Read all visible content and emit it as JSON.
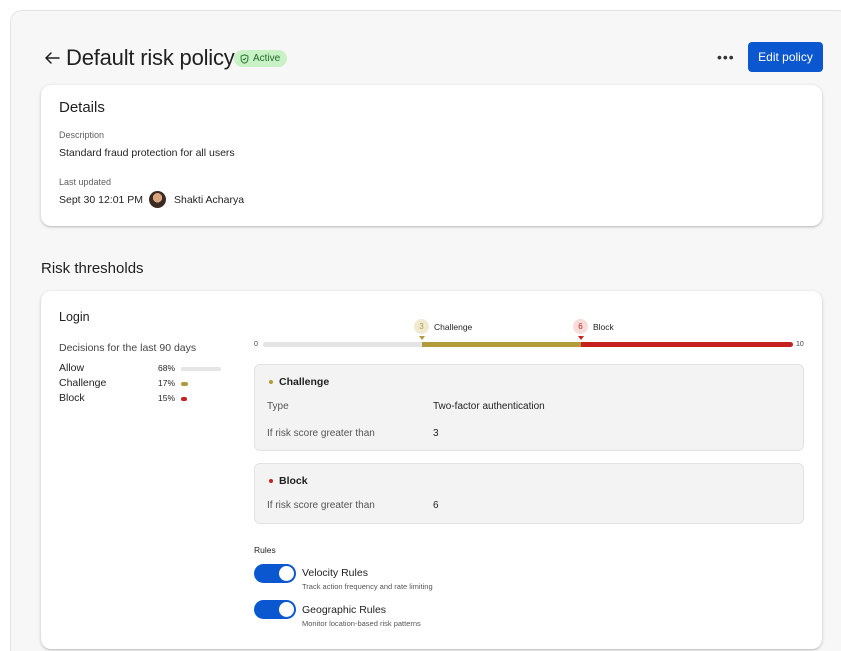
{
  "header": {
    "title": "Default risk policy",
    "status": "Active",
    "more_label": "•••",
    "edit_label": "Edit policy"
  },
  "details": {
    "title": "Details",
    "description_label": "Description",
    "description_value": "Standard fraud protection for all users",
    "updated_label": "Last updated",
    "updated_value": "Sept 30 12:01 PM",
    "updated_by": "Shakti Acharya"
  },
  "risk_thresholds": {
    "heading": "Risk thresholds",
    "login": {
      "title": "Login",
      "decisions_heading": "Decisions for the last 90 days",
      "decisions": [
        {
          "name": "Allow",
          "percent": "68%",
          "fraction": 0.68,
          "color": "#e6e6e6"
        },
        {
          "name": "Challenge",
          "percent": "17%",
          "fraction": 0.17,
          "color": "#b39a3a"
        },
        {
          "name": "Block",
          "percent": "15%",
          "fraction": 0.15,
          "color": "#c5221f"
        }
      ],
      "scale": {
        "min": "0",
        "max": "10",
        "min_value": 0,
        "max_value": 10
      },
      "markers": [
        {
          "value": 3,
          "label": "Challenge",
          "color": "#b39a3a",
          "badge_bg": "#f1ead2"
        },
        {
          "value": 6,
          "label": "Block",
          "color": "#c5221f",
          "badge_bg": "#f8dcda"
        }
      ],
      "challenge": {
        "title": "Challenge",
        "type_label": "Type",
        "type_value": "Two-factor authentication",
        "threshold_label": "If risk score greater than",
        "threshold_value": "3"
      },
      "block": {
        "title": "Block",
        "threshold_label": "If risk score greater than",
        "threshold_value": "6"
      },
      "rules_heading": "Rules",
      "rules": [
        {
          "name": "Velocity Rules",
          "description": "Track action frequency and rate limiting",
          "enabled": true
        },
        {
          "name": "Geographic Rules",
          "description": "Monitor location-based risk patterns",
          "enabled": true
        }
      ]
    }
  },
  "colors": {
    "accent": "#0b57d0",
    "active_badge": "#c8f1c5",
    "challenge": "#b39a3a",
    "block": "#c5221f"
  }
}
